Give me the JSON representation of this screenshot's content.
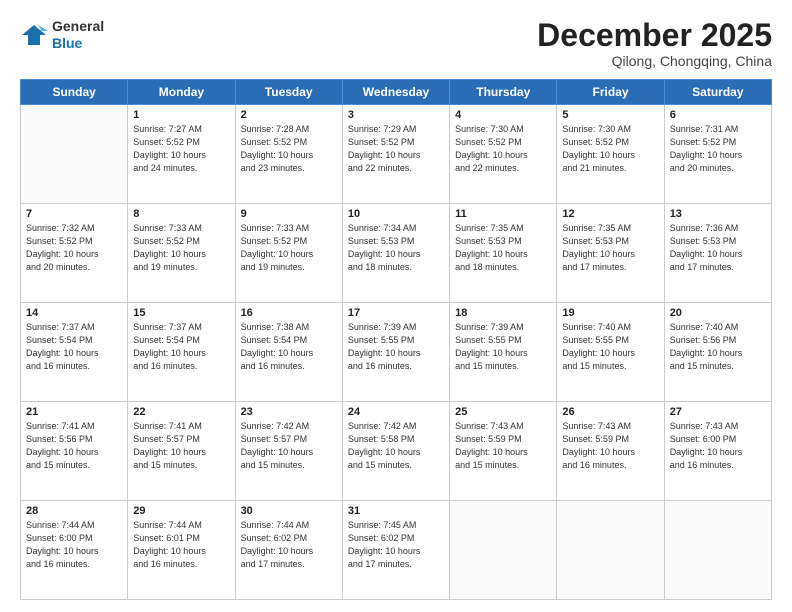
{
  "logo": {
    "general": "General",
    "blue": "Blue"
  },
  "header": {
    "month": "December 2025",
    "location": "Qilong, Chongqing, China"
  },
  "weekdays": [
    "Sunday",
    "Monday",
    "Tuesday",
    "Wednesday",
    "Thursday",
    "Friday",
    "Saturday"
  ],
  "weeks": [
    [
      {
        "day": "",
        "info": ""
      },
      {
        "day": "1",
        "info": "Sunrise: 7:27 AM\nSunset: 5:52 PM\nDaylight: 10 hours\nand 24 minutes."
      },
      {
        "day": "2",
        "info": "Sunrise: 7:28 AM\nSunset: 5:52 PM\nDaylight: 10 hours\nand 23 minutes."
      },
      {
        "day": "3",
        "info": "Sunrise: 7:29 AM\nSunset: 5:52 PM\nDaylight: 10 hours\nand 22 minutes."
      },
      {
        "day": "4",
        "info": "Sunrise: 7:30 AM\nSunset: 5:52 PM\nDaylight: 10 hours\nand 22 minutes."
      },
      {
        "day": "5",
        "info": "Sunrise: 7:30 AM\nSunset: 5:52 PM\nDaylight: 10 hours\nand 21 minutes."
      },
      {
        "day": "6",
        "info": "Sunrise: 7:31 AM\nSunset: 5:52 PM\nDaylight: 10 hours\nand 20 minutes."
      }
    ],
    [
      {
        "day": "7",
        "info": "Sunrise: 7:32 AM\nSunset: 5:52 PM\nDaylight: 10 hours\nand 20 minutes."
      },
      {
        "day": "8",
        "info": "Sunrise: 7:33 AM\nSunset: 5:52 PM\nDaylight: 10 hours\nand 19 minutes."
      },
      {
        "day": "9",
        "info": "Sunrise: 7:33 AM\nSunset: 5:52 PM\nDaylight: 10 hours\nand 19 minutes."
      },
      {
        "day": "10",
        "info": "Sunrise: 7:34 AM\nSunset: 5:53 PM\nDaylight: 10 hours\nand 18 minutes."
      },
      {
        "day": "11",
        "info": "Sunrise: 7:35 AM\nSunset: 5:53 PM\nDaylight: 10 hours\nand 18 minutes."
      },
      {
        "day": "12",
        "info": "Sunrise: 7:35 AM\nSunset: 5:53 PM\nDaylight: 10 hours\nand 17 minutes."
      },
      {
        "day": "13",
        "info": "Sunrise: 7:36 AM\nSunset: 5:53 PM\nDaylight: 10 hours\nand 17 minutes."
      }
    ],
    [
      {
        "day": "14",
        "info": "Sunrise: 7:37 AM\nSunset: 5:54 PM\nDaylight: 10 hours\nand 16 minutes."
      },
      {
        "day": "15",
        "info": "Sunrise: 7:37 AM\nSunset: 5:54 PM\nDaylight: 10 hours\nand 16 minutes."
      },
      {
        "day": "16",
        "info": "Sunrise: 7:38 AM\nSunset: 5:54 PM\nDaylight: 10 hours\nand 16 minutes."
      },
      {
        "day": "17",
        "info": "Sunrise: 7:39 AM\nSunset: 5:55 PM\nDaylight: 10 hours\nand 16 minutes."
      },
      {
        "day": "18",
        "info": "Sunrise: 7:39 AM\nSunset: 5:55 PM\nDaylight: 10 hours\nand 15 minutes."
      },
      {
        "day": "19",
        "info": "Sunrise: 7:40 AM\nSunset: 5:55 PM\nDaylight: 10 hours\nand 15 minutes."
      },
      {
        "day": "20",
        "info": "Sunrise: 7:40 AM\nSunset: 5:56 PM\nDaylight: 10 hours\nand 15 minutes."
      }
    ],
    [
      {
        "day": "21",
        "info": "Sunrise: 7:41 AM\nSunset: 5:56 PM\nDaylight: 10 hours\nand 15 minutes."
      },
      {
        "day": "22",
        "info": "Sunrise: 7:41 AM\nSunset: 5:57 PM\nDaylight: 10 hours\nand 15 minutes."
      },
      {
        "day": "23",
        "info": "Sunrise: 7:42 AM\nSunset: 5:57 PM\nDaylight: 10 hours\nand 15 minutes."
      },
      {
        "day": "24",
        "info": "Sunrise: 7:42 AM\nSunset: 5:58 PM\nDaylight: 10 hours\nand 15 minutes."
      },
      {
        "day": "25",
        "info": "Sunrise: 7:43 AM\nSunset: 5:59 PM\nDaylight: 10 hours\nand 15 minutes."
      },
      {
        "day": "26",
        "info": "Sunrise: 7:43 AM\nSunset: 5:59 PM\nDaylight: 10 hours\nand 16 minutes."
      },
      {
        "day": "27",
        "info": "Sunrise: 7:43 AM\nSunset: 6:00 PM\nDaylight: 10 hours\nand 16 minutes."
      }
    ],
    [
      {
        "day": "28",
        "info": "Sunrise: 7:44 AM\nSunset: 6:00 PM\nDaylight: 10 hours\nand 16 minutes."
      },
      {
        "day": "29",
        "info": "Sunrise: 7:44 AM\nSunset: 6:01 PM\nDaylight: 10 hours\nand 16 minutes."
      },
      {
        "day": "30",
        "info": "Sunrise: 7:44 AM\nSunset: 6:02 PM\nDaylight: 10 hours\nand 17 minutes."
      },
      {
        "day": "31",
        "info": "Sunrise: 7:45 AM\nSunset: 6:02 PM\nDaylight: 10 hours\nand 17 minutes."
      },
      {
        "day": "",
        "info": ""
      },
      {
        "day": "",
        "info": ""
      },
      {
        "day": "",
        "info": ""
      }
    ]
  ]
}
